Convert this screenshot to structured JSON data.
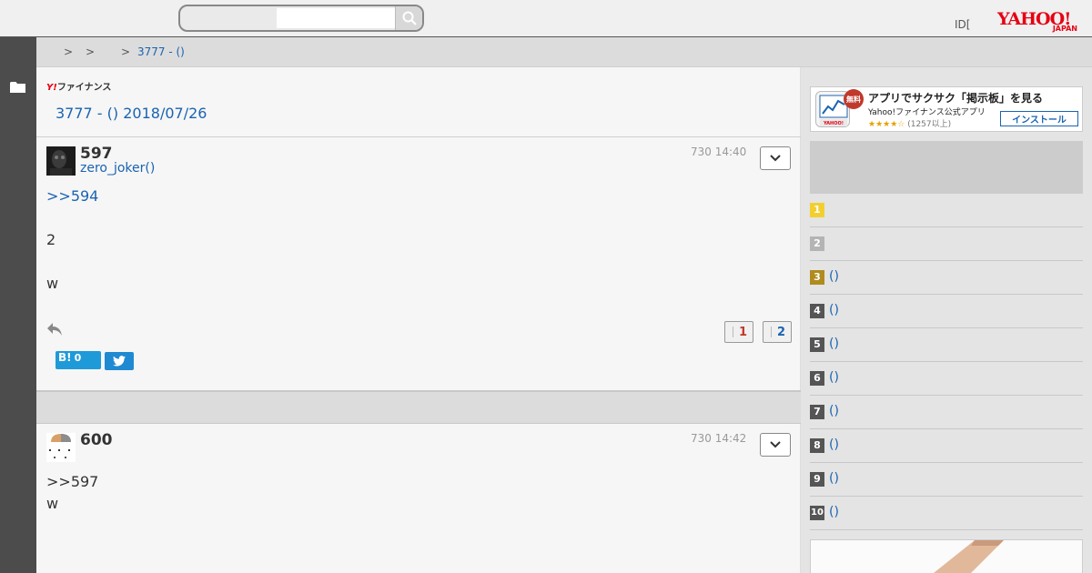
{
  "header": {
    "search_placeholder": "",
    "user_id_label": "ID[",
    "logo_text": "YAHOO!",
    "logo_sub": "JAPAN"
  },
  "breadcrumb": {
    "separators": [
      ">",
      ">",
      ">"
    ],
    "current": "3777 - ()"
  },
  "board": {
    "service_logo_y": "Y!",
    "service_logo_text": "ファイナンス",
    "title": "3777 - () 2018/07/26"
  },
  "posts": [
    {
      "number": "597",
      "user": "zero_joker()",
      "time": "730 14:40",
      "lines": [
        ">>594",
        "2",
        "w"
      ],
      "votes_up": "1",
      "votes_down": "2",
      "hatena_label": "B!",
      "hatena_count": "0"
    },
    {
      "number": "600",
      "user": "",
      "time": "730 14:42",
      "lines": [
        ">>597",
        "w"
      ]
    }
  ],
  "sidebar": {
    "ad": {
      "badge": "無料",
      "title": "アプリでサクサク「掲示板」を見る",
      "subtitle": "Yahoo!ファイナンス公式アプリ",
      "stars": "★★★★☆",
      "review_count": "(1257以上)",
      "install_label": "インストール"
    },
    "ranking": [
      {
        "rank": "1",
        "label": "",
        "color": "#f2cf2f"
      },
      {
        "rank": "2",
        "label": "",
        "color": "#b4b4b4"
      },
      {
        "rank": "3",
        "label": "()",
        "color": "#b08b1e"
      },
      {
        "rank": "4",
        "label": "()",
        "color": "#555555"
      },
      {
        "rank": "5",
        "label": "()",
        "color": "#555555"
      },
      {
        "rank": "6",
        "label": "()",
        "color": "#555555"
      },
      {
        "rank": "7",
        "label": "()",
        "color": "#555555"
      },
      {
        "rank": "8",
        "label": "()",
        "color": "#555555"
      },
      {
        "rank": "9",
        "label": "()",
        "color": "#555555"
      },
      {
        "rank": "10",
        "label": "()",
        "color": "#555555"
      }
    ]
  },
  "colors": {
    "link": "#1a63b0",
    "left_rail": "#4c4c4c",
    "vote_up": "#c0392b",
    "vote_down": "#1a63b0"
  }
}
